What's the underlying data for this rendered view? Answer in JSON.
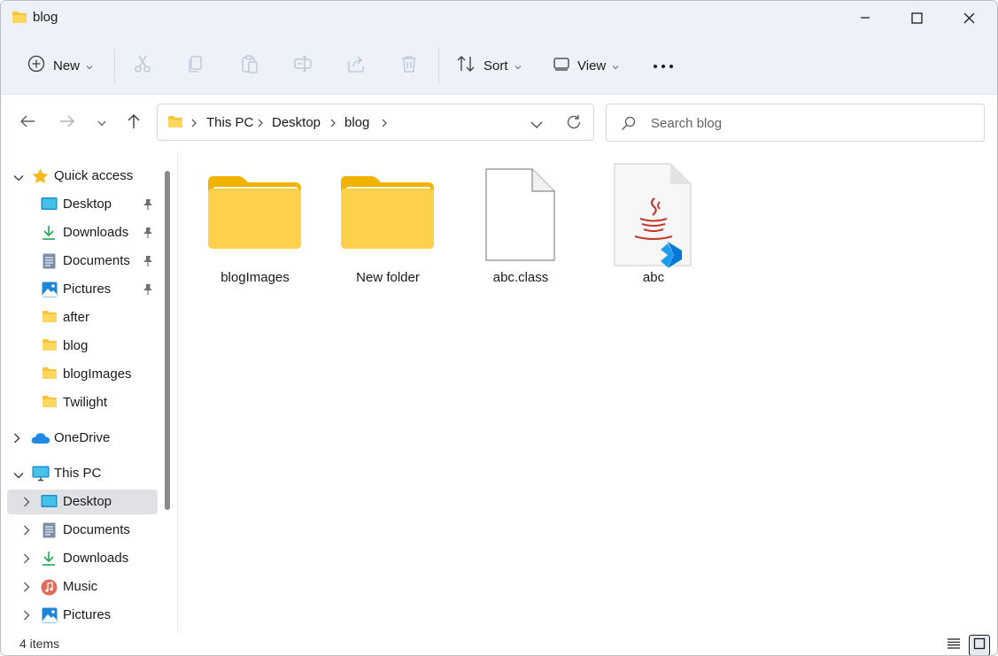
{
  "window": {
    "title": "blog"
  },
  "toolbar": {
    "new_label": "New",
    "sort_label": "Sort",
    "view_label": "View"
  },
  "address": {
    "crumbs": [
      "This PC",
      "Desktop",
      "blog"
    ]
  },
  "search": {
    "placeholder": "Search blog"
  },
  "sidebar": {
    "quick_access": {
      "label": "Quick access",
      "items": [
        {
          "label": "Desktop",
          "icon": "desktop-icon",
          "pinned": true
        },
        {
          "label": "Downloads",
          "icon": "download-icon",
          "pinned": true
        },
        {
          "label": "Documents",
          "icon": "documents-icon",
          "pinned": true
        },
        {
          "label": "Pictures",
          "icon": "pictures-icon",
          "pinned": true
        },
        {
          "label": "after",
          "icon": "folder-icon",
          "pinned": false
        },
        {
          "label": "blog",
          "icon": "folder-icon",
          "pinned": false
        },
        {
          "label": "blogImages",
          "icon": "folder-icon",
          "pinned": false
        },
        {
          "label": "Twilight",
          "icon": "folder-icon",
          "pinned": false
        }
      ]
    },
    "onedrive": {
      "label": "OneDrive"
    },
    "this_pc": {
      "label": "This PC",
      "items": [
        {
          "label": "Desktop",
          "icon": "desktop-icon",
          "selected": true
        },
        {
          "label": "Documents",
          "icon": "documents-icon"
        },
        {
          "label": "Downloads",
          "icon": "download-icon"
        },
        {
          "label": "Music",
          "icon": "music-icon"
        },
        {
          "label": "Pictures",
          "icon": "pictures-icon"
        }
      ]
    }
  },
  "files": [
    {
      "name": "blogImages",
      "type": "folder"
    },
    {
      "name": "New folder",
      "type": "folder"
    },
    {
      "name": "abc.class",
      "type": "generic-file"
    },
    {
      "name": "abc",
      "type": "java-file"
    }
  ],
  "status": {
    "item_count": "4 items"
  },
  "colors": {
    "folder": "#f8c43c",
    "accent": "#0067c0",
    "selection": "#dfe1e5"
  }
}
